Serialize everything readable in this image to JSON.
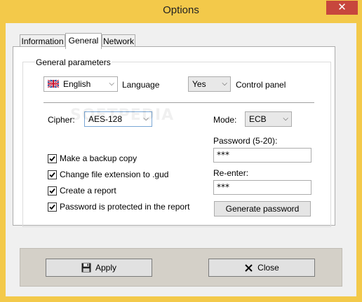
{
  "window": {
    "title": "Options",
    "close_glyph": "✕"
  },
  "tabs": [
    {
      "label": "Information",
      "active": false
    },
    {
      "label": "General",
      "active": true
    },
    {
      "label": "Network",
      "active": false
    }
  ],
  "general": {
    "group_label": "General parameters",
    "language": {
      "value": "English",
      "label": "Language",
      "flag_icon": "uk-flag-icon"
    },
    "control_panel": {
      "value": "Yes",
      "label": "Control panel"
    },
    "cipher": {
      "label": "Cipher:",
      "value": "AES-128"
    },
    "mode": {
      "label": "Mode:",
      "value": "ECB"
    },
    "password": {
      "label": "Password (5-20):",
      "value": "***"
    },
    "reenter": {
      "label": "Re-enter:",
      "value": "***"
    },
    "checkboxes": [
      {
        "label": "Make a backup copy",
        "checked": true
      },
      {
        "label": "Change file extension to .gud",
        "checked": true
      },
      {
        "label": "Create a report",
        "checked": true
      },
      {
        "label": "Password is protected in the report",
        "checked": true
      }
    ],
    "generate_button": "Generate password"
  },
  "footer": {
    "apply_label": "Apply",
    "close_label": "Close"
  },
  "colors": {
    "titlebar": "#f3c94a",
    "close_button": "#c7463d",
    "client_bg": "#f0f0f0",
    "footer_panel": "#d4d0c8"
  },
  "watermark": "SOFTPEDIA"
}
